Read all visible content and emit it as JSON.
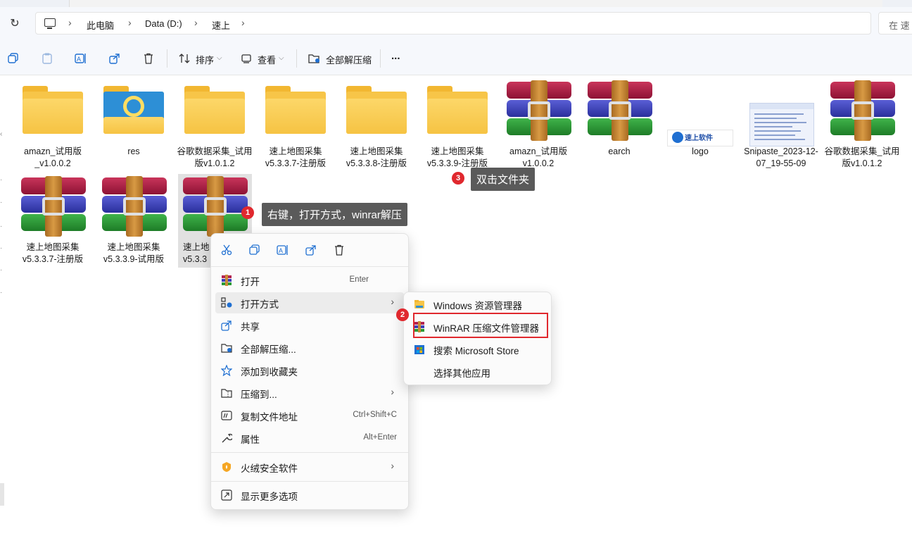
{
  "address": {
    "crumbs": [
      "此电脑",
      "Data (D:)",
      "速上"
    ],
    "search_placeholder": "在 速"
  },
  "toolbar": {
    "sort_label": "排序",
    "view_label": "查看",
    "extract_all_label": "全部解压缩",
    "more_label": "..."
  },
  "files": [
    {
      "type": "folder",
      "name": "amazn_试用版_v1.0.0.2"
    },
    {
      "type": "folder-image",
      "name": "res"
    },
    {
      "type": "folder",
      "name": "谷歌数据采集_试用版v1.0.1.2"
    },
    {
      "type": "folder",
      "name": "速上地图采集v5.3.3.7-注册版"
    },
    {
      "type": "folder",
      "name": "速上地图采集v5.3.3.8-注册版"
    },
    {
      "type": "folder",
      "name": "速上地图采集v5.3.3.9-注册版"
    },
    {
      "type": "rar",
      "name": "amazn_试用版v1.0.0.2"
    },
    {
      "type": "rar",
      "name": "earch"
    },
    {
      "type": "image-logo",
      "name": "logo"
    },
    {
      "type": "image-snip",
      "name": "Snipaste_2023-12-07_19-55-09"
    },
    {
      "type": "rar",
      "name": "谷歌数据采集_试用版v1.0.1.2"
    },
    {
      "type": "rar",
      "name": "速上地图采集v5.3.3.7-注册版"
    },
    {
      "type": "rar",
      "name": "速上地图采集v5.3.3.9-试用版"
    },
    {
      "type": "rar",
      "name": "速上地图采集v5.3.3"
    }
  ],
  "selected_label_part": "速上地",
  "selected_label_part2": "v5.3.3",
  "logo_text": "速上软件",
  "context_menu": {
    "items": [
      {
        "label": "打开",
        "shortcut": "Enter",
        "icon": "winrar-icon"
      },
      {
        "label": "打开方式",
        "submenu": true,
        "icon": "open-with-icon"
      },
      {
        "label": "共享",
        "icon": "share-icon"
      },
      {
        "label": "全部解压缩...",
        "icon": "extract-icon"
      },
      {
        "label": "添加到收藏夹",
        "icon": "star-icon"
      },
      {
        "label": "压缩到...",
        "submenu": true,
        "icon": "zip-folder-icon"
      },
      {
        "label": "复制文件地址",
        "shortcut": "Ctrl+Shift+C",
        "icon": "copy-path-icon"
      },
      {
        "label": "属性",
        "shortcut": "Alt+Enter",
        "icon": "wrench-icon"
      },
      {
        "label": "火绒安全软件",
        "submenu": true,
        "icon": "huorong-icon"
      },
      {
        "label": "显示更多选项",
        "icon": "more-options-icon"
      }
    ]
  },
  "submenu": {
    "items": [
      {
        "label": "Windows 资源管理器",
        "icon": "explorer-icon"
      },
      {
        "label": "WinRAR 压缩文件管理器",
        "icon": "winrar-icon"
      },
      {
        "label": "搜索 Microsoft Store",
        "icon": "store-icon"
      },
      {
        "label": "选择其他应用",
        "icon": ""
      }
    ]
  },
  "annotations": {
    "badge1": "1",
    "tip1": "右键，打开方式，winrar解压",
    "badge2": "2",
    "badge3": "3",
    "tip3": "双击文件夹"
  },
  "colors": {
    "accent_red": "#e0282e",
    "tooltip_bg": "#5a5a5a",
    "folder_yellow": "#f7c548"
  }
}
